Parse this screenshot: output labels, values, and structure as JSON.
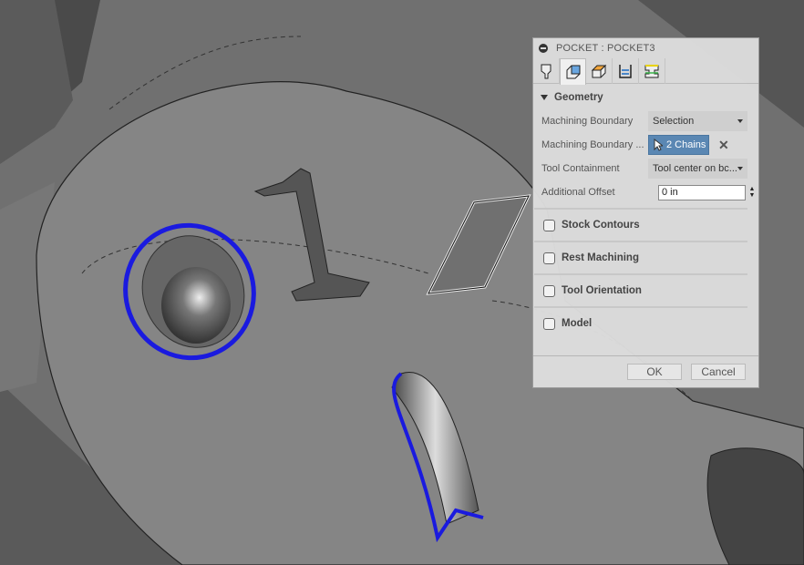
{
  "dialog": {
    "title": "POCKET : POCKET3",
    "tabs": [
      {
        "icon": "tool-icon"
      },
      {
        "icon": "geometry-icon",
        "active": true
      },
      {
        "icon": "heights-icon"
      },
      {
        "icon": "passes-icon"
      },
      {
        "icon": "linking-icon"
      }
    ],
    "geometry": {
      "heading": "Geometry",
      "fields": {
        "machining_boundary": {
          "label": "Machining Boundary",
          "value": "Selection"
        },
        "machining_boundary_sel": {
          "label": "Machining Boundary ...",
          "value": "2 Chains"
        },
        "tool_containment": {
          "label": "Tool Containment",
          "value": "Tool center on bc..."
        },
        "additional_offset": {
          "label": "Additional Offset",
          "value": "0 in"
        }
      }
    },
    "sections": [
      "Stock Contours",
      "Rest Machining",
      "Tool Orientation",
      "Model"
    ],
    "ok_label": "OK",
    "cancel_label": "Cancel"
  },
  "colors": {
    "selection_blue": "#1a1adf",
    "chains_button": "#5a87b3"
  },
  "model": {
    "engraved_text": "1"
  }
}
